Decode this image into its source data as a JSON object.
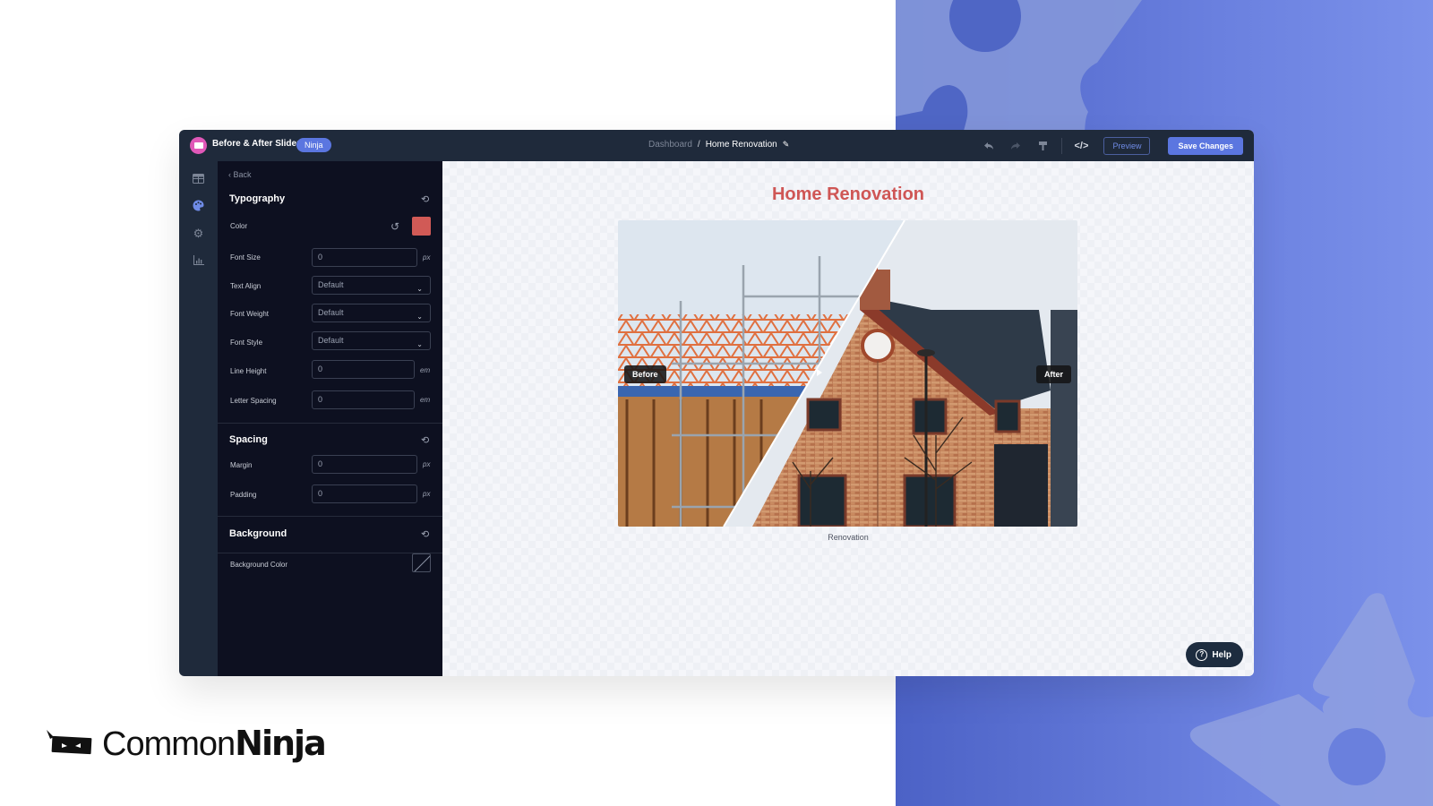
{
  "app": {
    "title": "Before & After Slider",
    "plan_badge": "Ninja"
  },
  "breadcrumb": {
    "parent": "Dashboard",
    "separator": "/",
    "current": "Home Renovation"
  },
  "toolbar": {
    "undo_icon": "undo-icon",
    "redo_icon": "redo-icon",
    "paint_icon": "paint-roller-icon",
    "code_label": "</>",
    "preview_label": "Preview",
    "save_label": "Save Changes"
  },
  "rail": {
    "items": [
      {
        "icon": "layout-grid-icon",
        "active": false
      },
      {
        "icon": "palette-icon",
        "active": true
      },
      {
        "icon": "gear-icon",
        "active": false
      },
      {
        "icon": "chart-icon",
        "active": false
      }
    ]
  },
  "panel": {
    "back_label": "Back",
    "typography": {
      "title": "Typography",
      "color_label": "Color",
      "color_value": "#d15a56",
      "font_size_label": "Font Size",
      "font_size_value": "0",
      "font_size_unit": "px",
      "text_align_label": "Text Align",
      "text_align_value": "Default",
      "font_weight_label": "Font Weight",
      "font_weight_value": "Default",
      "font_style_label": "Font Style",
      "font_style_value": "Default",
      "line_height_label": "Line Height",
      "line_height_value": "0",
      "line_height_unit": "em",
      "letter_spacing_label": "Letter Spacing",
      "letter_spacing_value": "0",
      "letter_spacing_unit": "em"
    },
    "spacing": {
      "title": "Spacing",
      "margin_label": "Margin",
      "margin_value": "0",
      "margin_unit": "px",
      "padding_label": "Padding",
      "padding_value": "0",
      "padding_unit": "px"
    },
    "background": {
      "title": "Background",
      "color_label": "Background Color"
    }
  },
  "preview": {
    "title": "Home Renovation",
    "before_label": "Before",
    "after_label": "After",
    "caption": "Renovation"
  },
  "help": {
    "label": "Help"
  },
  "brand": {
    "name_light": "Common",
    "name_bold": "Ninja"
  },
  "colors": {
    "accent": "#5b76e0",
    "title_red": "#cf5655",
    "topbar": "#1f2a3b",
    "panel": "#0d1020"
  }
}
